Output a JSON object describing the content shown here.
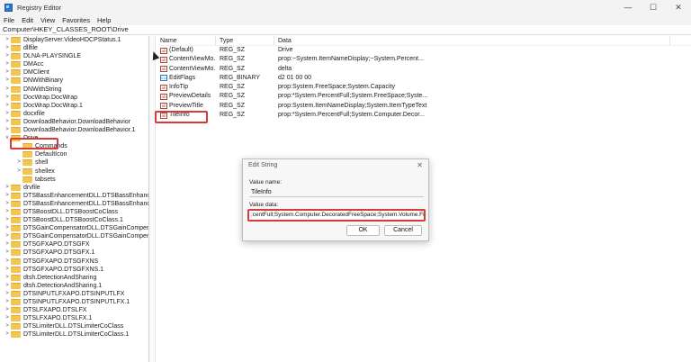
{
  "window": {
    "title": "Registry Editor",
    "controls": {
      "minimize": "—",
      "maximize": "☐",
      "close": "✕"
    }
  },
  "menu": [
    "File",
    "Edit",
    "View",
    "Favorites",
    "Help"
  ],
  "address": "Computer\\HKEY_CLASSES_ROOT\\Drive",
  "tree": [
    {
      "twisty": ">",
      "label": "DisplayServer.VideoHDCPStatus.1"
    },
    {
      "twisty": ">",
      "label": "dllfile"
    },
    {
      "twisty": ">",
      "label": "DLNA-PLAYSINGLE"
    },
    {
      "twisty": ">",
      "label": "DMAcc"
    },
    {
      "twisty": ">",
      "label": "DMClient"
    },
    {
      "twisty": ">",
      "label": "DNWithBinary"
    },
    {
      "twisty": ">",
      "label": "DNWithString"
    },
    {
      "twisty": ">",
      "label": "DocWrap.DocWrap"
    },
    {
      "twisty": ">",
      "label": "DocWrap.DocWrap.1"
    },
    {
      "twisty": ">",
      "label": "docxfile"
    },
    {
      "twisty": ">",
      "label": "DownloadBehavior.DownloadBehavior"
    },
    {
      "twisty": ">",
      "label": "DownloadBehavior.DownloadBehavior.1"
    },
    {
      "twisty": "v",
      "label": "Drive"
    },
    {
      "twisty": "",
      "label": "Commands",
      "indent": 1
    },
    {
      "twisty": "",
      "label": "DefaultIcon",
      "indent": 1
    },
    {
      "twisty": ">",
      "label": "shell",
      "indent": 1
    },
    {
      "twisty": ">",
      "label": "shellex",
      "indent": 1
    },
    {
      "twisty": "",
      "label": "tabsets",
      "indent": 1
    },
    {
      "twisty": ">",
      "label": "drvfile"
    },
    {
      "twisty": ">",
      "label": "DTSBassEnhancementDLL.DTSBassEnhancem"
    },
    {
      "twisty": ">",
      "label": "DTSBassEnhancementDLL.DTSBassEnhancem"
    },
    {
      "twisty": ">",
      "label": "DTSBoostDLL.DTSBoostCoClass"
    },
    {
      "twisty": ">",
      "label": "DTSBoostDLL.DTSBoostCoClass.1"
    },
    {
      "twisty": ">",
      "label": "DTSGainCompensatorDLL.DTSGainCompens"
    },
    {
      "twisty": ">",
      "label": "DTSGainCompensatorDLL.DTSGainCompens"
    },
    {
      "twisty": ">",
      "label": "DTSGFXAPO.DTSGFX"
    },
    {
      "twisty": ">",
      "label": "DTSGFXAPO.DTSGFX.1"
    },
    {
      "twisty": ">",
      "label": "DTSGFXAPO.DTSGFXNS"
    },
    {
      "twisty": ">",
      "label": "DTSGFXAPO.DTSGFXNS.1"
    },
    {
      "twisty": ">",
      "label": "dtsh.DetectionAndSharing"
    },
    {
      "twisty": ">",
      "label": "dtsh.DetectionAndSharing.1"
    },
    {
      "twisty": ">",
      "label": "DTSINPUTLFXAPO.DTSINPUTLFX"
    },
    {
      "twisty": ">",
      "label": "DTSINPUTLFXAPO.DTSINPUTLFX.1"
    },
    {
      "twisty": ">",
      "label": "DTSLFXAPO.DTSLFX"
    },
    {
      "twisty": ">",
      "label": "DTSLFXAPO.DTSLFX.1"
    },
    {
      "twisty": ">",
      "label": "DTSLimiterDLL.DTSLimiterCoClass"
    },
    {
      "twisty": ">",
      "label": "DTSLimiterDLL.DTSLimiterCoClass.1"
    }
  ],
  "list": {
    "headers": {
      "name": "Name",
      "type": "Type",
      "data": "Data"
    },
    "rows": [
      {
        "icon": "ab",
        "name": "(Default)",
        "type": "REG_SZ",
        "data": "Drive"
      },
      {
        "icon": "ab",
        "name": "ContentViewMo...",
        "type": "REG_SZ",
        "data": "prop:~System.ItemNameDisplay;~System.Percent..."
      },
      {
        "icon": "ab",
        "name": "ContentViewMo...",
        "type": "REG_SZ",
        "data": "delta"
      },
      {
        "icon": "bin",
        "name": "EditFlags",
        "type": "REG_BINARY",
        "data": "d2 01 00 00"
      },
      {
        "icon": "ab",
        "name": "InfoTip",
        "type": "REG_SZ",
        "data": "prop:System.FreeSpace;System.Capacity"
      },
      {
        "icon": "ab",
        "name": "PreviewDetails",
        "type": "REG_SZ",
        "data": "prop:*System.PercentFull;System.FreeSpace;Syste..."
      },
      {
        "icon": "ab",
        "name": "PreviewTitle",
        "type": "REG_SZ",
        "data": "prop:System.ItemNameDisplay;System.ItemTypeText"
      },
      {
        "icon": "ab",
        "name": "TileInfo",
        "type": "REG_SZ",
        "data": "prop:*System.PercentFull;System.Computer.Decor..."
      }
    ]
  },
  "dialog": {
    "title": "Edit String",
    "close": "✕",
    "value_name_label": "Value name:",
    "value_name": "TileInfo",
    "value_data_label": "Value data:",
    "value_data": ";centFull;System.Computer.DecoratedFreeSpace;System.Volume.FileSystem",
    "ok_label": "OK",
    "cancel_label": "Cancel"
  },
  "colors": {
    "highlight": "#d93a3a",
    "folder": "#f3c553"
  }
}
